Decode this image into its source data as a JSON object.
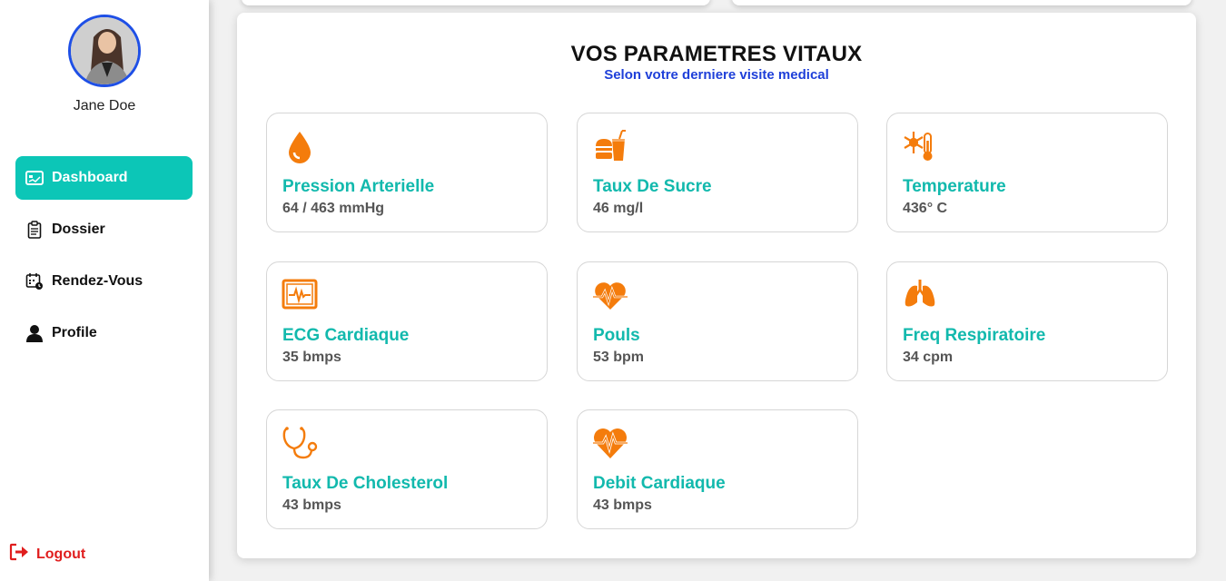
{
  "user": {
    "name": "Jane Doe"
  },
  "nav": [
    {
      "label": "Dashboard",
      "icon": "dashboard-icon",
      "active": true
    },
    {
      "label": "Dossier",
      "icon": "clipboard-icon",
      "active": false
    },
    {
      "label": "Rendez-Vous",
      "icon": "calendar-icon",
      "active": false
    },
    {
      "label": "Profile",
      "icon": "user-icon",
      "active": false
    }
  ],
  "logout": {
    "label": "Logout",
    "icon": "logout-icon"
  },
  "panel": {
    "title": "VOS PARAMETRES VITAUX",
    "subtitle": "Selon votre derniere visite medical"
  },
  "vitals": [
    {
      "name": "Pression Arterielle",
      "value": "64 / 463 mmHg",
      "icon": "blood-drop-icon"
    },
    {
      "name": "Taux De Sucre",
      "value": "46 mg/l",
      "icon": "food-drink-icon"
    },
    {
      "name": "Temperature",
      "value": "436° C",
      "icon": "thermometer-icon"
    },
    {
      "name": "ECG Cardiaque",
      "value": "35 bmps",
      "icon": "ecg-monitor-icon"
    },
    {
      "name": "Pouls",
      "value": "53 bpm",
      "icon": "heart-pulse-icon"
    },
    {
      "name": "Freq Respiratoire",
      "value": "34 cpm",
      "icon": "lungs-icon"
    },
    {
      "name": "Taux De Cholesterol",
      "value": "43 bmps",
      "icon": "stethoscope-icon"
    },
    {
      "name": "Debit Cardiaque",
      "value": "43 bmps",
      "icon": "heart-rate-icon"
    }
  ],
  "colors": {
    "accent": "#0cc6b7",
    "vital_name": "#12b9ad",
    "icon_orange": "#f47c0c",
    "subtitle": "#1e3fd9",
    "logout": "#e01e1e",
    "avatar_border": "#1e4fe6"
  }
}
